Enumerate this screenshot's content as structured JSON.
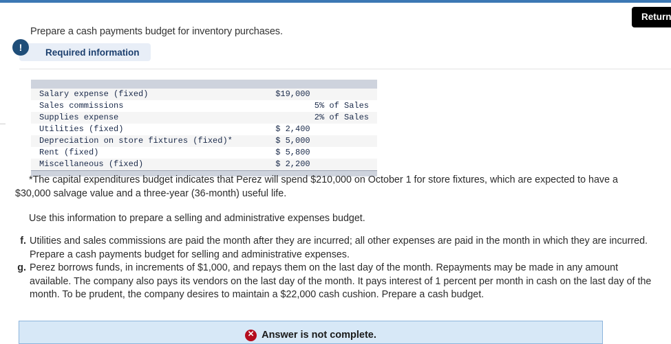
{
  "top_bar": {
    "color": "#3c78b4"
  },
  "header": {
    "return_button_label": "Return to question",
    "question_heading": "Prepare a cash payments budget for inventory purchases.",
    "required_info_label": "Required information",
    "exclamation_glyph": "!"
  },
  "table": {
    "rows": [
      {
        "label": "Salary expense (fixed)",
        "value": "$19,000",
        "align": "left"
      },
      {
        "label": "Sales commissions",
        "value": "5% of Sales",
        "align": "right"
      },
      {
        "label": "Supplies expense",
        "value": "2% of Sales",
        "align": "right"
      },
      {
        "label": "Utilities (fixed)",
        "value": "$ 2,400",
        "align": "left"
      },
      {
        "label": "Depreciation on store fixtures (fixed)*",
        "value": "$ 5,000",
        "align": "left"
      },
      {
        "label": "Rent (fixed)",
        "value": "$ 5,800",
        "align": "left"
      },
      {
        "label": "Miscellaneous (fixed)",
        "value": "$ 2,200",
        "align": "left"
      }
    ]
  },
  "body": {
    "footnote": "*The capital expenditures budget indicates that Perez will spend $210,000 on October 1 for store fixtures, which are expected to have a $30,000 salvage value and a three-year (36-month) useful life.",
    "use_information": "Use this information to prepare a selling and administrative expenses budget.",
    "items": [
      {
        "marker": "f.",
        "text": "Utilities and sales commissions are paid the month after they are incurred; all other expenses are paid in the month in which they are incurred. Prepare a cash payments budget for selling and administrative expenses."
      },
      {
        "marker": "g.",
        "text": "Perez borrows funds, in increments of $1,000, and repays them on the last day of the month. Repayments may be made in any amount available. The company also pays its vendors on the last day of the month. It pays interest of 1 percent per month in cash on the last day of the month. To be prudent, the company desires to maintain a $22,000 cash cushion. Prepare a cash budget."
      }
    ]
  },
  "answer_status": {
    "icon_glyph": "✕",
    "text": "Answer is not complete.",
    "icon_color": "#b50d1e",
    "panel_bg": "#d7e8f7",
    "panel_border": "#8cb4dc"
  }
}
